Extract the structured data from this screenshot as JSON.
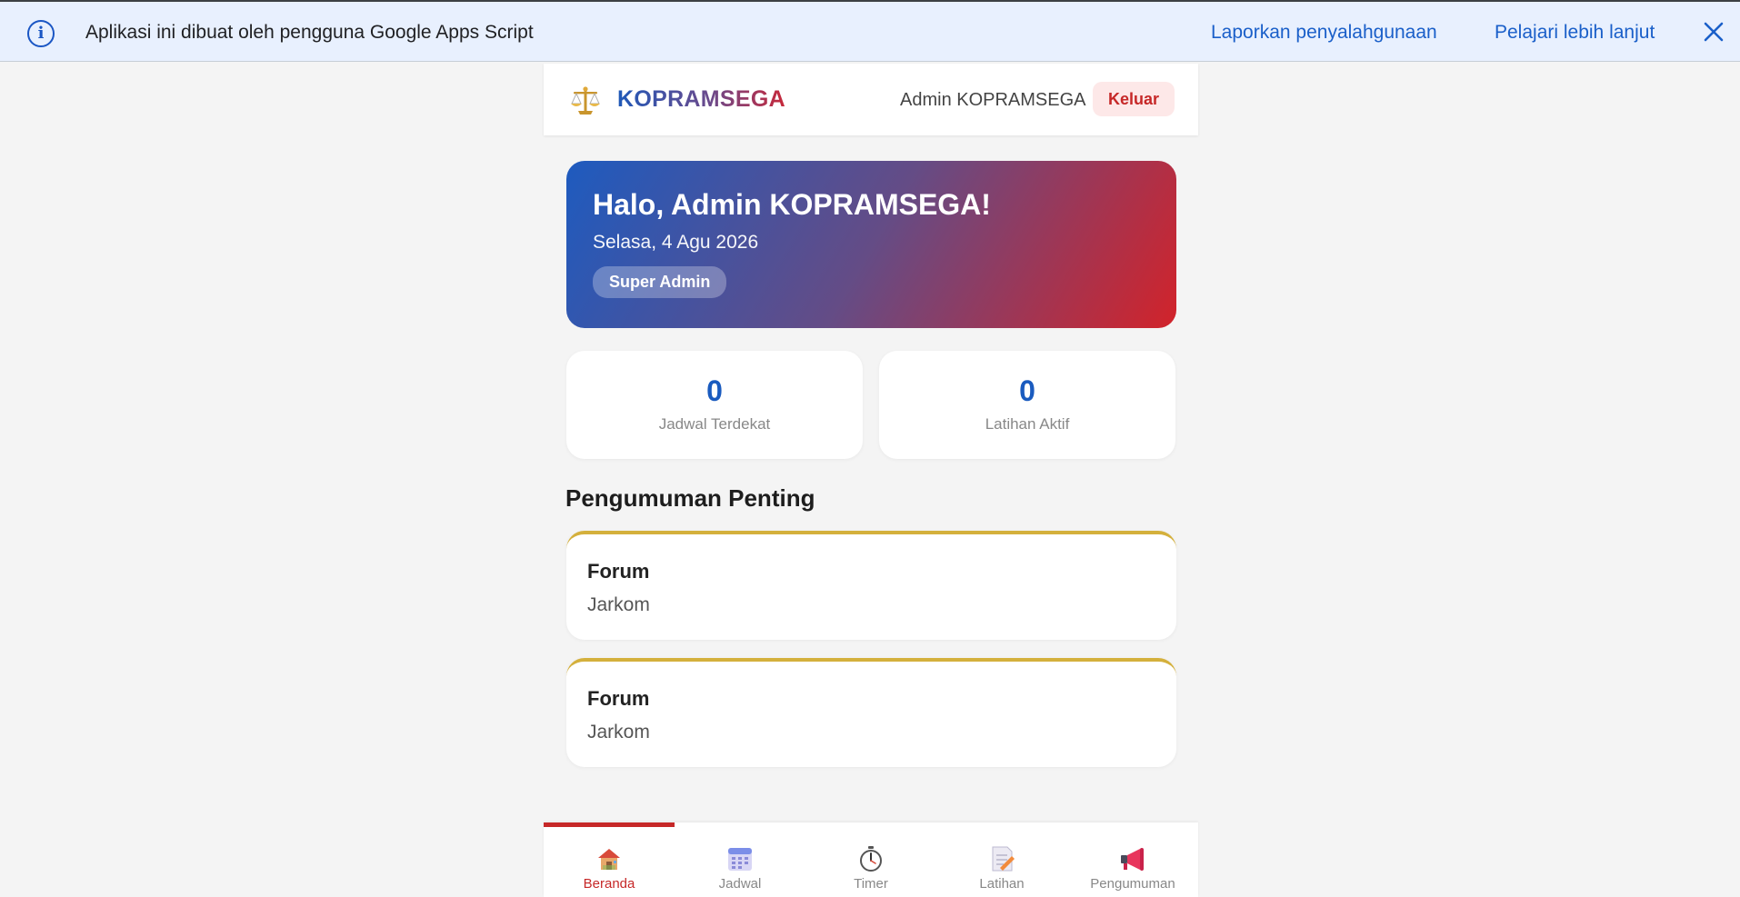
{
  "banner": {
    "message": "Aplikasi ini dibuat oleh pengguna Google Apps Script",
    "report_link": "Laporkan penyalahgunaan",
    "learn_link": "Pelajari lebih lanjut"
  },
  "header": {
    "brand": "KOPRAMSEGA",
    "user": "Admin KOPRAMSEGA",
    "logout": "Keluar"
  },
  "hero": {
    "greeting": "Halo, Admin KOPRAMSEGA!",
    "date": "Selasa, 4 Agu 2026",
    "role": "Super Admin"
  },
  "stats": [
    {
      "value": "0",
      "label": "Jadwal Terdekat"
    },
    {
      "value": "0",
      "label": "Latihan Aktif"
    }
  ],
  "announcements": {
    "title": "Pengumuman Penting",
    "items": [
      {
        "title": "Forum",
        "body": "Jarkom"
      },
      {
        "title": "Forum",
        "body": "Jarkom"
      }
    ]
  },
  "nav": [
    {
      "label": "Beranda",
      "icon": "home-icon",
      "active": true
    },
    {
      "label": "Jadwal",
      "icon": "calendar-icon",
      "active": false
    },
    {
      "label": "Timer",
      "icon": "stopwatch-icon",
      "active": false
    },
    {
      "label": "Latihan",
      "icon": "memo-icon",
      "active": false
    },
    {
      "label": "Pengumuman",
      "icon": "megaphone-icon",
      "active": false
    }
  ],
  "colors": {
    "accent_red": "#c62828",
    "accent_blue": "#1a5bbf",
    "gold": "#d4b03c"
  }
}
